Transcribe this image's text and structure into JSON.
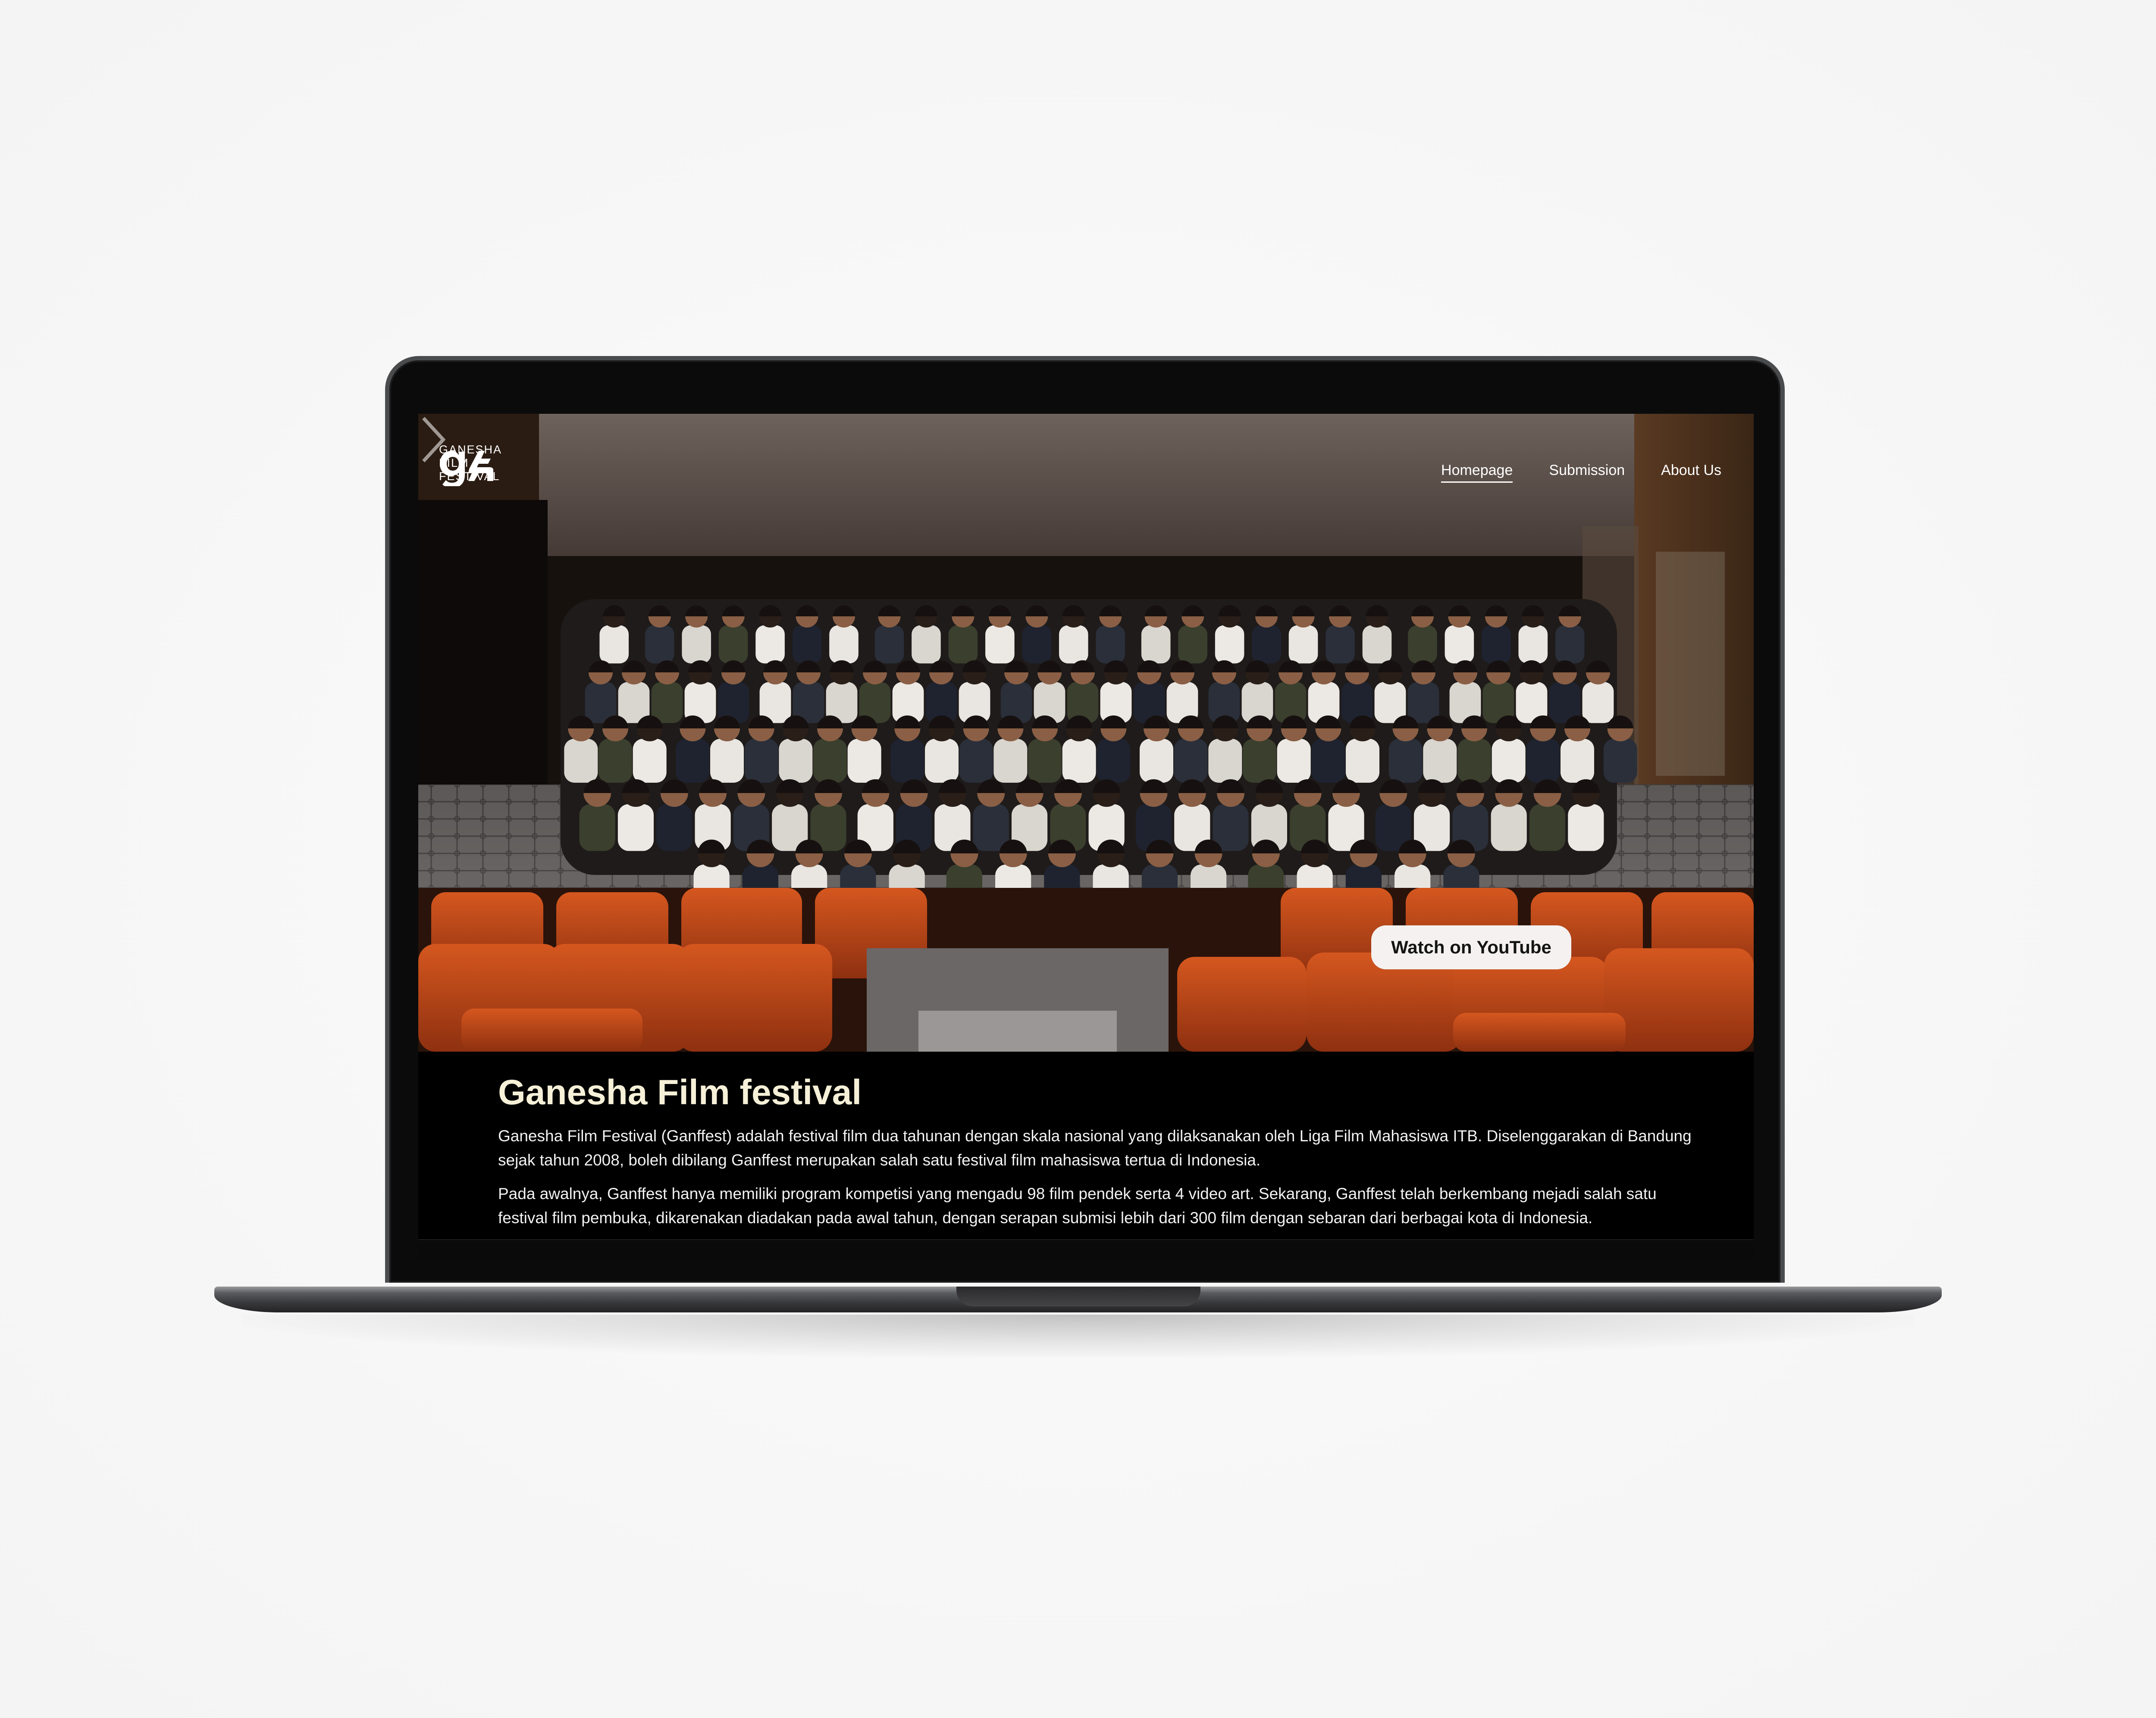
{
  "brand": {
    "logo_lines": [
      "GANESHA",
      "FILM",
      "FESTIVAL"
    ]
  },
  "nav": {
    "items": [
      {
        "label": "Homepage",
        "active": true
      },
      {
        "label": "Submission",
        "active": false
      },
      {
        "label": "About Us",
        "active": false
      }
    ]
  },
  "hero": {
    "watch_label": "Watch on YouTube"
  },
  "intro": {
    "title": "Ganesha Film festival",
    "paragraphs": [
      "Ganesha Film Festival (Ganffest) adalah festival film dua tahunan dengan skala nasional yang dilaksanakan oleh Liga Film Mahasiswa ITB. Diselenggarakan di Bandung sejak tahun 2008, boleh dibilang Ganffest merupakan salah satu festival film mahasiswa tertua di Indonesia.",
      "Pada awalnya, Ganffest hanya memiliki program kompetisi yang mengadu 98 film pendek serta 4 video art. Sekarang, Ganffest telah berkembang mejadi salah satu festival film pembuka, dikarenakan diadakan pada awal tahun, dengan serapan submisi lebih dari 300 film dengan sebaran dari berbagai kota di Indonesia."
    ]
  },
  "colors": {
    "background": "#f7f7f7",
    "screen": "#000000",
    "title": "#f6f0d8",
    "seat_orange": "#c24a1a",
    "button_bg": "#f4f1f0"
  },
  "icons": [
    "logo-mark-icon",
    "chevron-right-icon"
  ]
}
